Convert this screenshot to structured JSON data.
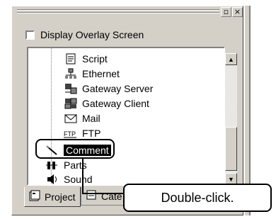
{
  "window": {
    "restore_glyph": "▫",
    "close_glyph": "×"
  },
  "overlay_checkbox": {
    "label": "Display Overlay Screen",
    "checked": false
  },
  "tree": {
    "items": [
      {
        "label": "Script",
        "icon": "script-icon"
      },
      {
        "label": "Ethernet",
        "icon": "ethernet-icon"
      },
      {
        "label": "Gateway Server",
        "icon": "gateway-server-icon"
      },
      {
        "label": "Gateway Client",
        "icon": "gateway-client-icon"
      },
      {
        "label": "Mail",
        "icon": "mail-icon"
      },
      {
        "label": "FTP",
        "icon": "ftp-icon"
      },
      {
        "label": "Comment",
        "icon": "comment-icon",
        "selected": true
      },
      {
        "label": "Parts",
        "icon": "parts-icon"
      },
      {
        "label": "Sound",
        "icon": "sound-icon"
      }
    ]
  },
  "scrollbar": {
    "up_glyph": "▲",
    "down_glyph": "▼"
  },
  "tabs": [
    {
      "label": "Project",
      "active": true
    },
    {
      "label": "Cate",
      "active": false
    }
  ],
  "callout": {
    "text": "Double-click."
  }
}
